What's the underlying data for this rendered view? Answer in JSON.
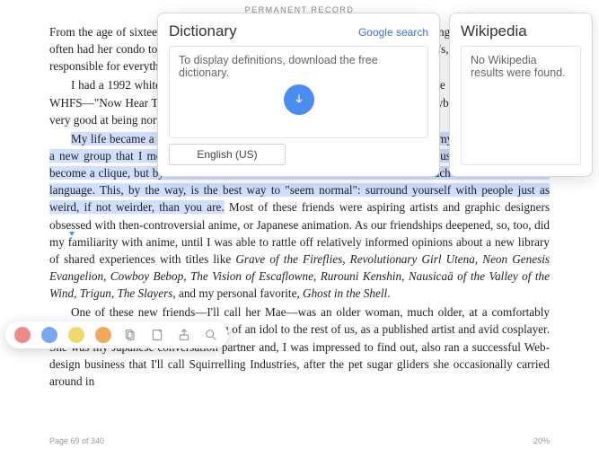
{
  "book": {
    "title": "PERMANENT RECORD"
  },
  "footer": {
    "page": "Page 69 of 340",
    "percent": "20%"
  },
  "para1": {
    "pre": "From the age of sixteen, I was pretty much living on my own. With my mother engrossed in her work, I often had her condo to myself, as she spent nights and weekends at her boyfriend's, doing laundry. I was responsible for everything but paying the bills."
  },
  "para2": {
    "text": "I had a 1992 white Honda Civic and drove it all over the state, listening to the indie alternative 99.1 WHFS—\"Now Hear This\" was one of its catchphrases—because that's what everybody else did. I wasn't very good at being normal, but I was trying."
  },
  "para3": {
    "hl": "My life became a circuit, tracing a route between my home, my college, and my friends, particularly a new group that I met in Japanese class. I'm not quite sure how long it took us to realize that we'd become a clique, but by the second semester we attended class as much to see each other as to learn the language. This, by the way, is the best way to \"seem normal\": surround yourself with people just as weird, if not weirder, than you are.",
    "rest": " Most of these friends were aspiring artists and graphic designers obsessed with then-controversial anime, or Japanese animation. As our friendships deepened, so, too, did my familiarity with anime, until I was able to rattle off relatively informed opinions about a new library of shared experiences with titles like ",
    "titles": "Grave of the Fireflies, Revolutionary Girl Utena, Neon Genesis Evangelion, Cowboy Bebop, The Vision of Escaflowne, Rurouni Kenshin, Nausicaä of the Valley of the Wind, Trigun, The Slayers",
    "mid": ", and my personal favorite, ",
    "last": "Ghost in the Shell",
    "end": "."
  },
  "para4": {
    "text": "One of these new friends—I'll call her Mae—was an older woman, much older, at a comfortably adult twenty-five. She was something of an idol to the rest of us, as a published artist and avid cosplayer. She was my Japanese conversation partner and, I was impressed to find out, also ran a successful Web-design business that I'll call Squirrelling Industries, after the pet sugar gliders she occasionally carried around in"
  },
  "dictionary": {
    "title": "Dictionary",
    "google": "Google search",
    "body": "To display definitions, download the free dictionary.",
    "lang": "English (US)"
  },
  "wikipedia": {
    "title": "Wikipedia",
    "body": "No Wikipedia results were found."
  }
}
